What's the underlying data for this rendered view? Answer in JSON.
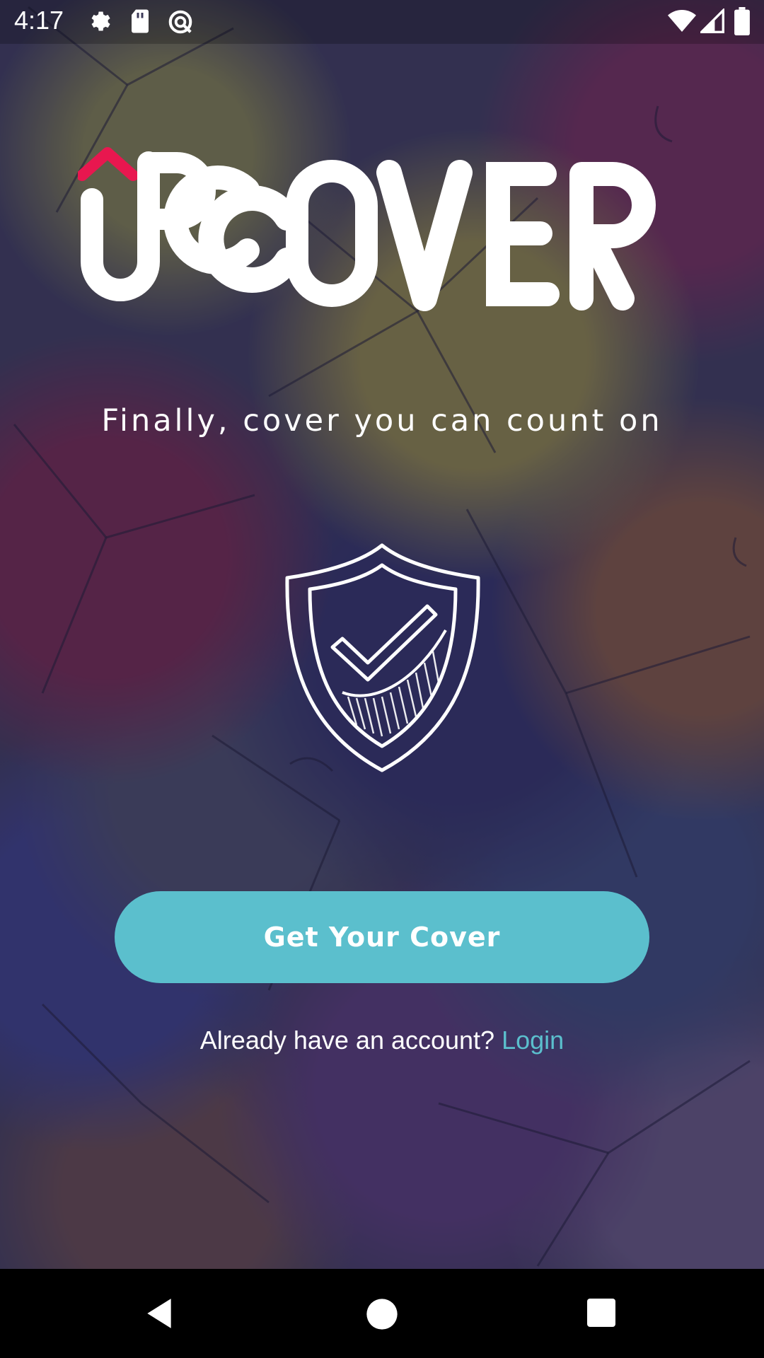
{
  "status_bar": {
    "time": "4:17",
    "left_icons": [
      "gear-icon",
      "sd-card-icon",
      "data-saver-icon"
    ],
    "right_icons": [
      "wifi-icon",
      "signal-icon",
      "battery-icon"
    ]
  },
  "brand": {
    "logo_text": "UPCOVER",
    "accent_color": "#e8174f"
  },
  "tagline": "Finally, cover you can count on",
  "hero_icon": "shield-check-icon",
  "cta": {
    "label": "Get Your Cover",
    "color": "#5bbfcd"
  },
  "login": {
    "prompt": "Already have an account?",
    "link_label": "Login",
    "link_color": "#5bbfcd"
  },
  "nav_bar": {
    "buttons": [
      "back-icon",
      "home-icon",
      "recents-icon"
    ]
  }
}
